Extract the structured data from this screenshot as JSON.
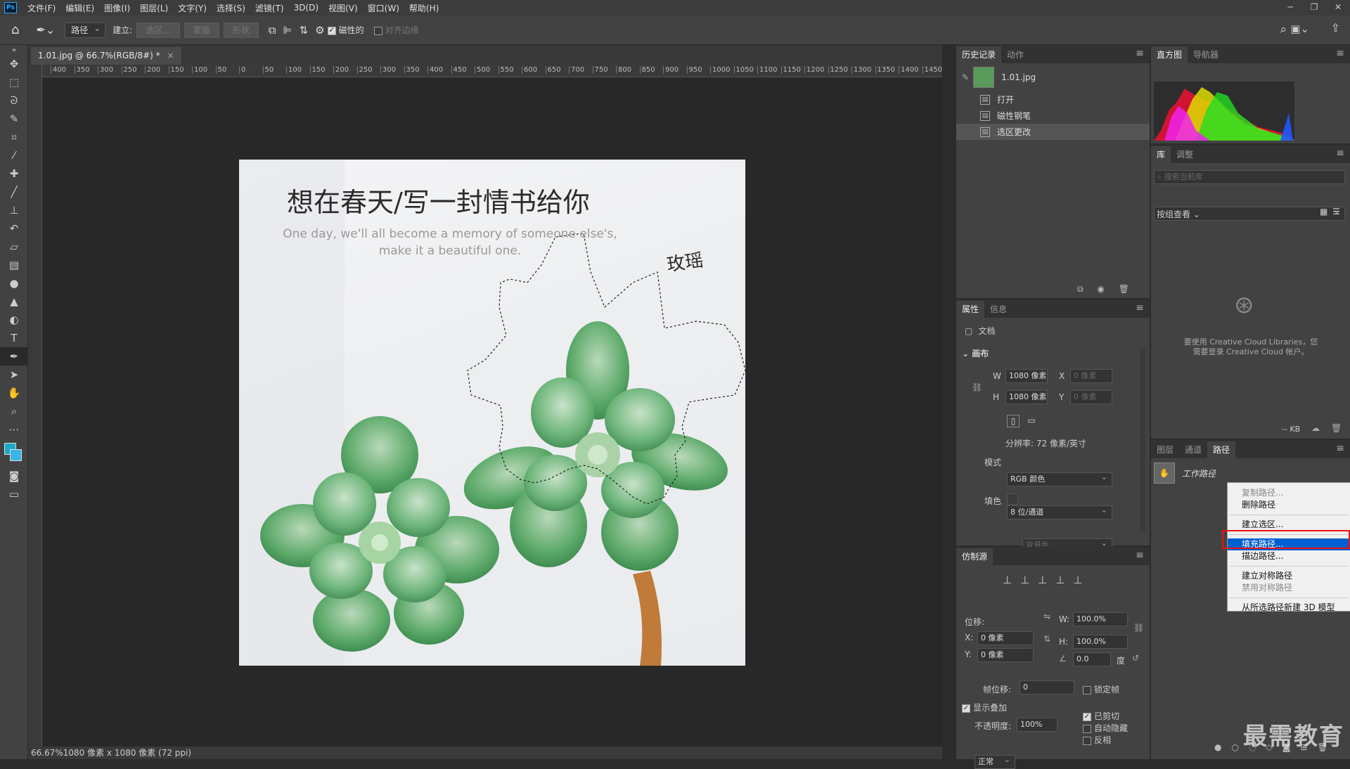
{
  "app": {
    "logo": "Ps"
  },
  "menus": [
    "文件(F)",
    "编辑(E)",
    "图像(I)",
    "图层(L)",
    "文字(Y)",
    "选择(S)",
    "滤镜(T)",
    "3D(D)",
    "视图(V)",
    "窗口(W)",
    "帮助(H)"
  ],
  "window_controls": {
    "minimize": "─",
    "restore": "❐",
    "close": "✕"
  },
  "options": {
    "mode_value": "路径",
    "make_label": "建立:",
    "selection_btn": "选区...",
    "mask_btn": "蒙版",
    "shape_btn": "形状",
    "magnetic_label": "磁性的",
    "align_edges_label": "对齐边缘"
  },
  "document_tab": {
    "title": "1.01.jpg @ 66.7%(RGB/8#) *",
    "close": "×"
  },
  "ruler": {
    "ticks": [
      "400",
      "350",
      "300",
      "250",
      "200",
      "150",
      "100",
      "50",
      "0",
      "50",
      "100",
      "150",
      "200",
      "250",
      "300",
      "350",
      "400",
      "450",
      "500",
      "550",
      "600",
      "650",
      "700",
      "750",
      "800",
      "850",
      "900",
      "950",
      "1000",
      "1050",
      "1100",
      "1150",
      "1200",
      "1250",
      "1300",
      "1350",
      "1400",
      "1450"
    ]
  },
  "image": {
    "title": "想在春天/写一封情书给你",
    "subtitle_line1": "One day, we'll all become a memory of someone else's,",
    "subtitle_line2": "make it a beautiful one.",
    "signature": "玫瑶"
  },
  "status": {
    "text": "66.67%1080 像素 x 1080 像素 (72 ppi)"
  },
  "history": {
    "tabs": [
      "历史记录",
      "动作"
    ],
    "snapshot": "1.01.jpg",
    "steps": [
      "打开",
      "磁性钢笔",
      "选区更改"
    ]
  },
  "properties": {
    "tabs": [
      "属性",
      "信息"
    ],
    "doc_label": "文档",
    "canvas_label": "画布",
    "w_label": "W",
    "w_value": "1080 像素",
    "x_label": "X",
    "x_placeholder": "0 像素",
    "h_label": "H",
    "h_value": "1080 像素",
    "y_label": "Y",
    "y_placeholder": "0 像素",
    "resolution": "分辨率: 72 像素/英寸",
    "mode_label": "模式",
    "mode_value": "RGB 颜色",
    "depth_value": "8 位/通道",
    "fill_label": "填色",
    "fill_value": "背景色"
  },
  "clone": {
    "tab": "仿制源",
    "offset_label": "位移:",
    "x_label": "X:",
    "x_value": "0 像素",
    "y_label": "Y:",
    "y_value": "0 像素",
    "w_label": "W:",
    "w_value": "100.0%",
    "h_label": "H:",
    "h_value": "100.0%",
    "angle_value": "0.0",
    "angle_unit": "度",
    "frame_label": "帧位移:",
    "frame_value": "0",
    "lock_frame": "锁定帧",
    "show_overlay": "显示叠加",
    "opacity_label": "不透明度:",
    "opacity_value": "100%",
    "clipped": "已剪切",
    "auto_hide": "自动隐藏",
    "invert": "反相",
    "blend_value": "正常"
  },
  "histogram": {
    "tabs": [
      "直方图",
      "导航器"
    ]
  },
  "library": {
    "tabs": [
      "库",
      "调整"
    ],
    "search_placeholder": "搜索当前库",
    "view_label": "按组查看",
    "message_line1": "要使用 Creative Cloud Libraries，您",
    "message_line2": "需要登录 Creative Cloud 帐户。",
    "size": "-- KB"
  },
  "paths": {
    "tabs": [
      "图层",
      "通道",
      "路径"
    ],
    "work_path": "工作路径"
  },
  "context_menu": {
    "items": [
      "复制路径...",
      "删除路径",
      "建立选区...",
      "填充路径...",
      "描边路径...",
      "建立对称路径",
      "禁用对称路径",
      "从所选路径新建 3D 模型"
    ]
  },
  "watermark": "最需教育",
  "colors": {
    "accent": "#31a8ff",
    "selection": "#0060d0",
    "highlight_box": "#e11111"
  }
}
